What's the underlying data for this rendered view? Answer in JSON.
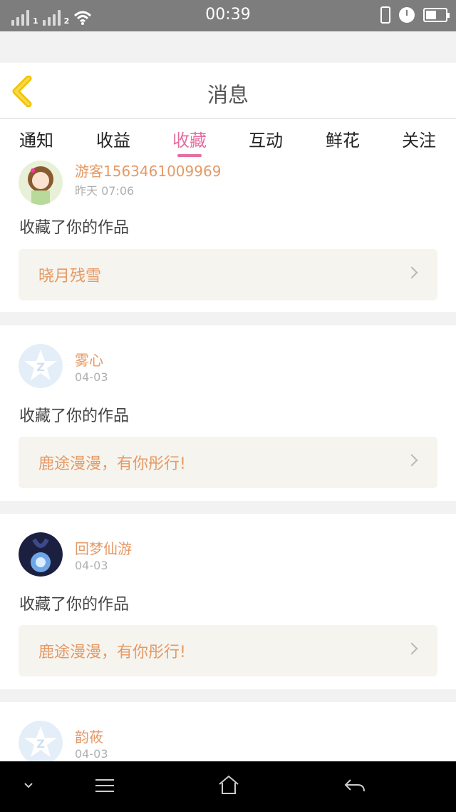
{
  "status_bar": {
    "time": "00:39",
    "sim1": "1",
    "sim2": "2",
    "icons": [
      "signal-icon",
      "signal-icon",
      "wifi-icon",
      "vibrate-icon",
      "alarm-icon",
      "battery-icon"
    ]
  },
  "header": {
    "title": "消息",
    "back_icon": "chevron-left-icon"
  },
  "tabs": [
    {
      "label": "通知",
      "active": false
    },
    {
      "label": "收益",
      "active": false
    },
    {
      "label": "收藏",
      "active": true
    },
    {
      "label": "互动",
      "active": false
    },
    {
      "label": "鲜花",
      "active": false
    },
    {
      "label": "关注",
      "active": false
    }
  ],
  "colors": {
    "accent_pink": "#e56ea0",
    "username_orange": "#e59a66",
    "back_yellow": "#f2c200"
  },
  "items": [
    {
      "user": "游客1563461009969",
      "time": "昨天 07:06",
      "action": "收藏了你的作品",
      "work": "晓月残雪",
      "avatar": "girl-avatar"
    },
    {
      "user": "雾心",
      "time": "04-03",
      "action": "收藏了你的作品",
      "work": "鹿途漫漫，有你彤行!",
      "avatar": "default-star-avatar"
    },
    {
      "user": "回梦仙游",
      "time": "04-03",
      "action": "收藏了你的作品",
      "work": "鹿途漫漫，有你彤行!",
      "avatar": "night-avatar"
    },
    {
      "user": "韵莜",
      "time": "04-03",
      "action": "",
      "work": "",
      "avatar": "default-star-avatar"
    }
  ],
  "nav_bar": [
    "chevron-down-icon",
    "menu-icon",
    "home-icon",
    "back-icon"
  ]
}
